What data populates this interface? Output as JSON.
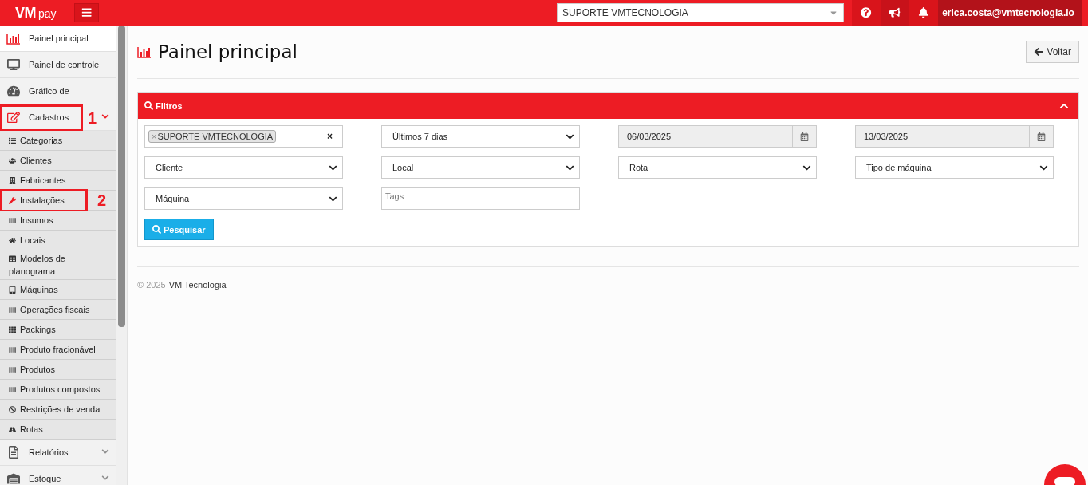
{
  "header": {
    "logo": {
      "brand": "VM",
      "suffix": "pay"
    },
    "company_select": {
      "value": "SUPORTE VMTECNOLOGIA"
    },
    "user": {
      "email": "erica.costa@vmtecnologia.io"
    }
  },
  "sidebar": {
    "items": [
      {
        "label": "Painel principal",
        "selected": true
      },
      {
        "label": "Painel de controle",
        "selected": false
      },
      {
        "label": "Gráfico de",
        "selected": false
      },
      {
        "label": "Cadastros",
        "selected": false,
        "expanded": true,
        "marker": "1",
        "children": [
          {
            "label": "Categorias"
          },
          {
            "label": "Clientes"
          },
          {
            "label": "Fabricantes"
          },
          {
            "label": "Instalações",
            "marker": "2"
          },
          {
            "label": "Insumos"
          },
          {
            "label": "Locais"
          },
          {
            "label": "Modelos de planograma"
          },
          {
            "label": "Máquinas"
          },
          {
            "label": "Operações fiscais"
          },
          {
            "label": "Packings"
          },
          {
            "label": "Produto fracionável"
          },
          {
            "label": "Produtos"
          },
          {
            "label": "Produtos compostos"
          },
          {
            "label": "Restrições de venda"
          },
          {
            "label": "Rotas"
          }
        ]
      },
      {
        "label": "Relatórios",
        "selected": false,
        "expanded": false
      },
      {
        "label": "Estoque",
        "selected": false,
        "expanded": false
      }
    ]
  },
  "page": {
    "title": "Painel principal",
    "back_button": "Voltar"
  },
  "filters": {
    "title": "Filtros",
    "expanded": true,
    "fields": [
      {
        "kind": "tags",
        "tags": [
          {
            "label": "SUPORTE VMTECNOLOGIA",
            "remove": "×"
          }
        ],
        "clear": "×"
      },
      {
        "kind": "select",
        "value": "Últimos 7 dias"
      },
      {
        "kind": "date",
        "value": "06/03/2025"
      },
      {
        "kind": "date",
        "value": "13/03/2025"
      },
      {
        "kind": "select",
        "value": "Cliente"
      },
      {
        "kind": "select",
        "value": "Local"
      },
      {
        "kind": "select",
        "value": "Rota"
      },
      {
        "kind": "select",
        "value": "Tipo de máquina"
      },
      {
        "kind": "select",
        "value": "Máquina"
      },
      {
        "kind": "text",
        "placeholder": "Tags"
      }
    ],
    "search_button": "Pesquisar"
  },
  "footer": {
    "copyright": "© 2025",
    "company": "VM Tecnologia"
  }
}
